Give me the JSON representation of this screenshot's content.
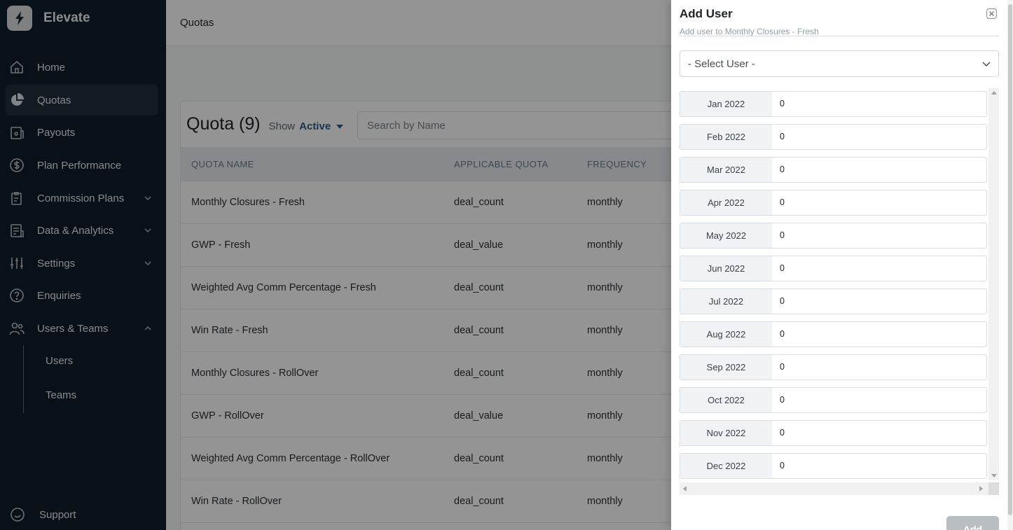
{
  "brand": {
    "name": "Elevate",
    "logo_icon": "bolt-icon"
  },
  "sidebar": {
    "items": [
      {
        "label": "Home",
        "icon": "home-icon"
      },
      {
        "label": "Quotas",
        "icon": "pie-chart-icon",
        "active": true
      },
      {
        "label": "Payouts",
        "icon": "payouts-icon"
      },
      {
        "label": "Plan Performance",
        "icon": "dollar-circle-icon"
      },
      {
        "label": "Commission Plans",
        "icon": "clipboard-icon",
        "expandable": true
      },
      {
        "label": "Data & Analytics",
        "icon": "report-icon",
        "expandable": true
      },
      {
        "label": "Settings",
        "icon": "sliders-icon",
        "expandable": true
      },
      {
        "label": "Enquiries",
        "icon": "question-circle-icon"
      },
      {
        "label": "Users & Teams",
        "icon": "users-icon",
        "expandable": true,
        "expanded": true
      }
    ],
    "subitems": [
      "Users",
      "Teams"
    ],
    "support": {
      "label": "Support",
      "icon": "chat-icon"
    }
  },
  "header": {
    "title": "Quotas"
  },
  "quota_card": {
    "title": "Quota (9)",
    "show_label": "Show",
    "show_value": "Active",
    "search_placeholder": "Search by Name",
    "columns": [
      "QUOTA NAME",
      "APPLICABLE QUOTA",
      "FREQUENCY"
    ],
    "rows": [
      {
        "name": "Monthly Closures - Fresh",
        "quota": "deal_count",
        "frequency": "monthly"
      },
      {
        "name": "GWP - Fresh",
        "quota": "deal_value",
        "frequency": "monthly"
      },
      {
        "name": "Weighted Avg Comm Percentage - Fresh",
        "quota": "deal_count",
        "frequency": "monthly"
      },
      {
        "name": "Win Rate - Fresh",
        "quota": "deal_count",
        "frequency": "monthly"
      },
      {
        "name": "Monthly Closures - RollOver",
        "quota": "deal_count",
        "frequency": "monthly"
      },
      {
        "name": "GWP - RollOver",
        "quota": "deal_value",
        "frequency": "monthly"
      },
      {
        "name": "Weighted Avg Comm Percentage - RollOver",
        "quota": "deal_count",
        "frequency": "monthly"
      },
      {
        "name": "Win Rate - RollOver",
        "quota": "deal_count",
        "frequency": "monthly"
      }
    ]
  },
  "drawer": {
    "title": "Add User",
    "subtitle": "Add user to Monthly Closures - Fresh",
    "select_placeholder": "- Select User -",
    "months": [
      {
        "label": "Jan 2022",
        "value": "0"
      },
      {
        "label": "Feb 2022",
        "value": "0"
      },
      {
        "label": "Mar 2022",
        "value": "0"
      },
      {
        "label": "Apr 2022",
        "value": "0"
      },
      {
        "label": "May 2022",
        "value": "0"
      },
      {
        "label": "Jun 2022",
        "value": "0"
      },
      {
        "label": "Jul 2022",
        "value": "0"
      },
      {
        "label": "Aug 2022",
        "value": "0"
      },
      {
        "label": "Sep 2022",
        "value": "0"
      },
      {
        "label": "Oct 2022",
        "value": "0"
      },
      {
        "label": "Nov 2022",
        "value": "0"
      },
      {
        "label": "Dec 2022",
        "value": "0"
      }
    ],
    "add_label": "Add"
  },
  "colors": {
    "sidebar_bg": "#0e1e2a",
    "active_item_bg": "#1f2f3b",
    "accent": "#2d5f8a",
    "overlay": "rgba(0,0,0,0.42)"
  }
}
